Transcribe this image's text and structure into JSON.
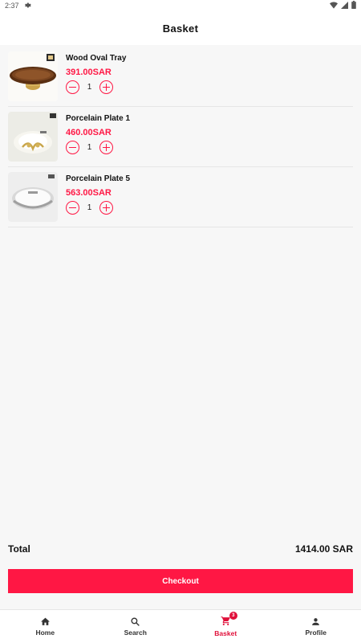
{
  "status": {
    "time": "2:37"
  },
  "header": {
    "title": "Basket"
  },
  "items": [
    {
      "name": "Wood Oval Tray",
      "price": "391.00SAR",
      "qty": "1"
    },
    {
      "name": "Porcelain Plate 1",
      "price": "460.00SAR",
      "qty": "1"
    },
    {
      "name": "Porcelain Plate 5",
      "price": "563.00SAR",
      "qty": "1"
    }
  ],
  "summary": {
    "total_label": "Total",
    "total_value": "1414.00 SAR"
  },
  "checkout_label": "Checkout",
  "nav": [
    {
      "label": "Home",
      "icon": "home-icon"
    },
    {
      "label": "Search",
      "icon": "search-icon"
    },
    {
      "label": "Basket",
      "icon": "cart-icon",
      "badge": "3",
      "active": true
    },
    {
      "label": "Profile",
      "icon": "person-icon"
    }
  ],
  "colors": {
    "accent": "#ff1744",
    "nav_active": "#e0103a"
  }
}
